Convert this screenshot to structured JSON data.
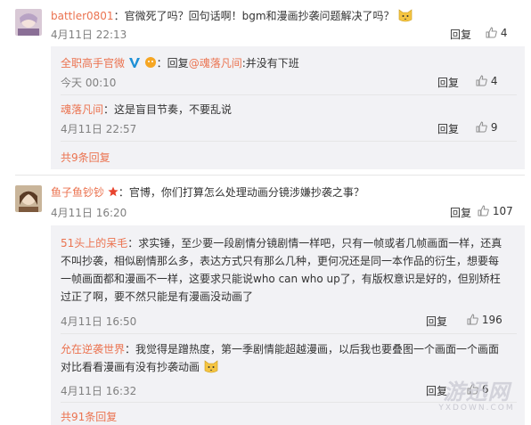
{
  "comments": [
    {
      "author": "battler0801",
      "colon": "：",
      "text": "官微死了吗？回句话啊！bgm和漫画抄袭问题解决了吗？",
      "time": "4月11日 22:13",
      "reply_label": "回复",
      "likes": "4",
      "replies": [
        {
          "author": "全职高手官微",
          "prefix": "：回复",
          "mention": "@魂落凡间",
          "text": ":并没有下班",
          "time": "今天 00:10",
          "reply_label": "回复",
          "likes": "4"
        },
        {
          "author": "魂落凡间",
          "prefix": "：",
          "text": "这是盲目节奏，不要乱说",
          "time": "4月11日 22:57",
          "reply_label": "回复",
          "likes": "9"
        }
      ],
      "more": "共9条回复"
    },
    {
      "author": "鱼子鱼钞钞",
      "colon": "：",
      "text": "官博，你们打算怎么处理动画分镜涉嫌抄袭之事？",
      "time": "4月11日 16:20",
      "reply_label": "回复",
      "likes": "107",
      "replies": [
        {
          "author": "51头上的呆毛",
          "prefix": "：",
          "lines": [
            "求实锤，至少要一段剧情分镜剧情一样吧，只有一帧或者几帧画面一样，还真",
            "不叫抄袭，相似剧情那么多，表达方式只有那么几种，更何况还是同一本作品的衍生，想要每",
            "一帧画面都和漫画不一样，这要求只能说who can who up了，有版权意识是好的，但别矫枉",
            "过正了啊，要不然只能是有漫画没动画了"
          ],
          "time": "4月11日 16:50",
          "reply_label": "回复",
          "likes": "196"
        },
        {
          "author": "允在逆袭世界",
          "prefix": "：",
          "lines": [
            "我觉得是蹭热度，第一季剧情能超越漫画，以后我也要叠图一个画面一个画面",
            "对比看看漫画有没有抄袭动画"
          ],
          "time": "4月11日 16:32",
          "reply_label": "回复",
          "likes": "6"
        }
      ],
      "more": "共91条回复"
    }
  ],
  "watermark": {
    "main": "游迅网",
    "sub": "YXDOWN.COM"
  },
  "colors": {
    "name": "#eb7350",
    "panel": "#f2f2f5",
    "time": "#808080",
    "link": "#eb7350"
  }
}
